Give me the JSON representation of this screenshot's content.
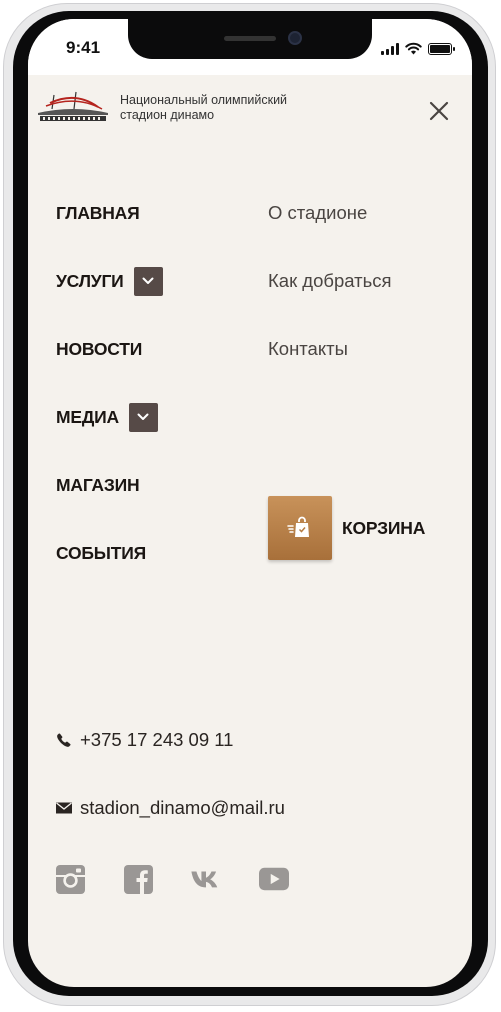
{
  "status_bar": {
    "time": "9:41"
  },
  "header": {
    "brand_line1": "Национальный олимпийский",
    "brand_line2": "стадион динамо"
  },
  "nav_main": [
    {
      "label": "ГЛАВНАЯ",
      "has_dropdown": false
    },
    {
      "label": "УСЛУГИ",
      "has_dropdown": true
    },
    {
      "label": "НОВОСТИ",
      "has_dropdown": false
    },
    {
      "label": "МЕДИА",
      "has_dropdown": true
    },
    {
      "label": "МАГАЗИН",
      "has_dropdown": false
    },
    {
      "label": "СОБЫТИЯ",
      "has_dropdown": false
    }
  ],
  "nav_secondary": [
    {
      "label": "О стадионе"
    },
    {
      "label": "Как добраться"
    },
    {
      "label": "Контакты"
    }
  ],
  "cart": {
    "label": "КОРЗИНА",
    "icon": "shopping-bag-icon"
  },
  "contacts": {
    "phone": "+375 17 243 09 11",
    "email": "stadion_dinamo@mail.ru"
  },
  "social": [
    {
      "icon": "instagram-icon"
    },
    {
      "icon": "facebook-icon"
    },
    {
      "icon": "vk-icon"
    },
    {
      "icon": "youtube-icon"
    }
  ],
  "colors": {
    "background": "#f5f2ed",
    "dropdown_toggle": "#564a47",
    "cart_accent": "#b57d44",
    "social_icons": "#9a9795",
    "logo_red": "#b5241e"
  }
}
